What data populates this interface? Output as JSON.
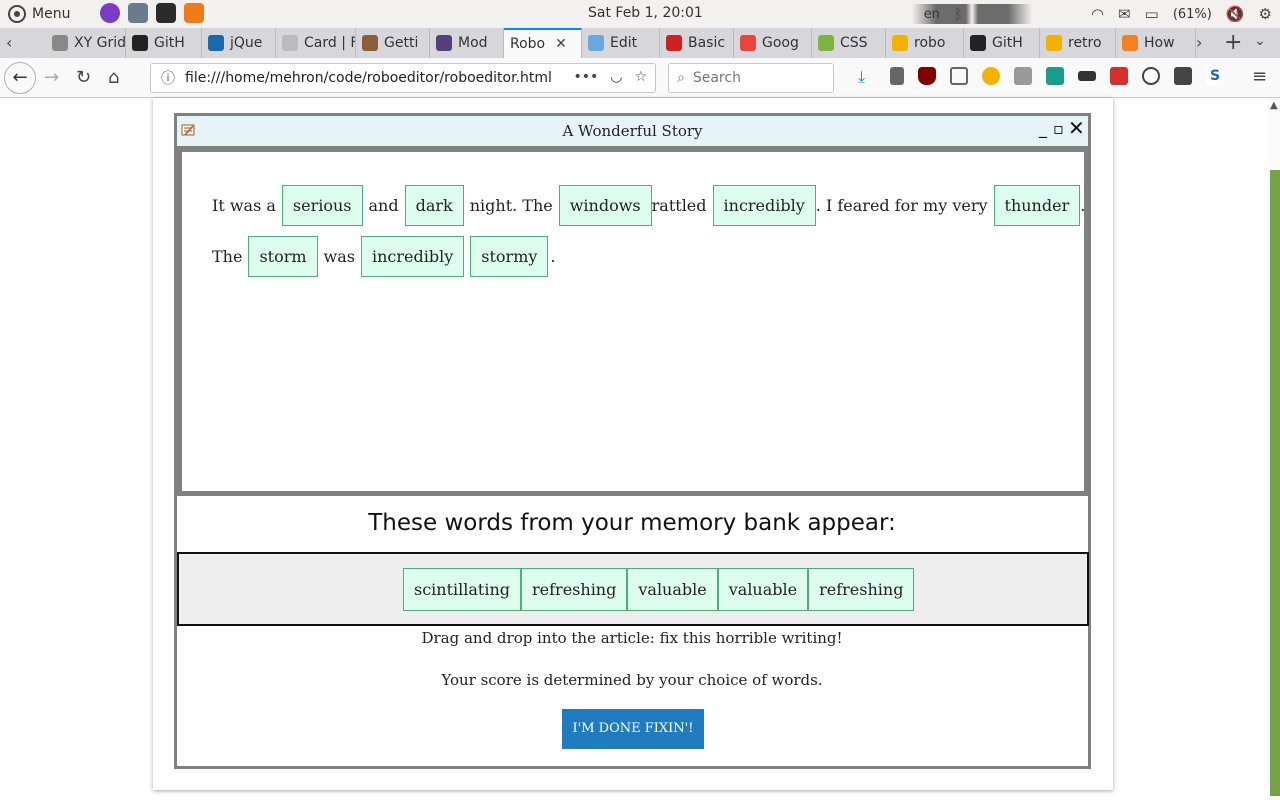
{
  "os_bar": {
    "menu_label": "Menu",
    "clock": "Sat Feb  1, 20:01",
    "lang": "en",
    "battery": "(61%)"
  },
  "tabs": [
    {
      "label": "XY Grid",
      "icon": "generic-tab-icon",
      "color": "#888888"
    },
    {
      "label": "GitH",
      "icon": "github-icon",
      "color": "#222222"
    },
    {
      "label": "jQue",
      "icon": "jquery-icon",
      "color": "#1b68ad"
    },
    {
      "label": "Card | Fo",
      "icon": "generic-tab-icon",
      "color": "#bbbbbb"
    },
    {
      "label": "Getti",
      "icon": "pug-icon",
      "color": "#8b5e3c"
    },
    {
      "label": "Mod",
      "icon": "bootstrap-icon",
      "color": "#563d7c"
    },
    {
      "label": "Robo",
      "icon": "none",
      "color": "#f9f9fa",
      "active": true
    },
    {
      "label": "Edit",
      "icon": "cloud-icon",
      "color": "#6aa9e0"
    },
    {
      "label": "Basic",
      "icon": "wm-icon",
      "color": "#cc2222"
    },
    {
      "label": "Goog",
      "icon": "fonts-icon",
      "color": "#e8453c"
    },
    {
      "label": "CSS",
      "icon": "css-icon",
      "color": "#7cb342"
    },
    {
      "label": "robo",
      "icon": "chrome-icon",
      "color": "#f2b200"
    },
    {
      "label": "GitH",
      "icon": "github-icon",
      "color": "#222222"
    },
    {
      "label": "retro",
      "icon": "chrome-icon",
      "color": "#f2b200"
    },
    {
      "label": "How",
      "icon": "stackoverflow-icon",
      "color": "#f48024"
    }
  ],
  "nav": {
    "url": "file:///home/mehron/code/roboeditor/roboeditor.html",
    "search_placeholder": "Search"
  },
  "window": {
    "title": "A Wonderful Story",
    "line1": {
      "t1": "It was a",
      "w1": "serious",
      "t2": "and",
      "w2": "dark",
      "t3": "night. The",
      "w3": "windows",
      "t4": "rattled",
      "w4": "incredibly",
      "t5": ". I feared for my very",
      "w5": "thunder",
      "t6": "."
    },
    "line2": {
      "t1": "The",
      "w1": "storm",
      "t2": "was",
      "w2": "incredibly",
      "w3": "stormy",
      "t3": "."
    }
  },
  "memory_bank": {
    "heading": "These words from your memory bank appear:",
    "words": [
      "scintillating",
      "refreshing",
      "valuable",
      "valuable",
      "refreshing"
    ]
  },
  "instructions": {
    "drag": "Drag and drop into the article: fix this horrible writing!",
    "score": "Your score is determined by your choice of words."
  },
  "done_button": "I'M DONE FIXIN'!",
  "colors": {
    "word_bg": "#ddfdef",
    "word_border": "#4caf7a",
    "button_bg": "#1f7cbf",
    "titlebar_bg": "#e6f4f8",
    "scroll_thumb": "#77a246"
  }
}
